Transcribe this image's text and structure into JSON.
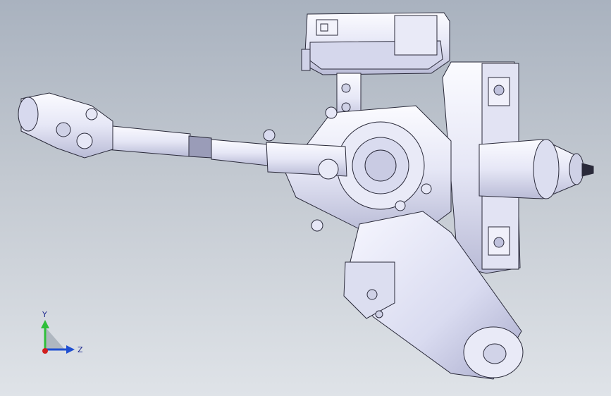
{
  "viewport": {
    "background_top": "#a9b2bf",
    "background_bottom": "#dfe3e8",
    "model_color": "#e9eaf7",
    "edge_color": "#2a2a3a",
    "content": "steering-column-assembly-3d-model"
  },
  "triad": {
    "y_label": "Y",
    "z_label": "Z",
    "y_color": "#2fbf3a",
    "z_color": "#1f4fd1",
    "x_color": "#d11f1f"
  }
}
